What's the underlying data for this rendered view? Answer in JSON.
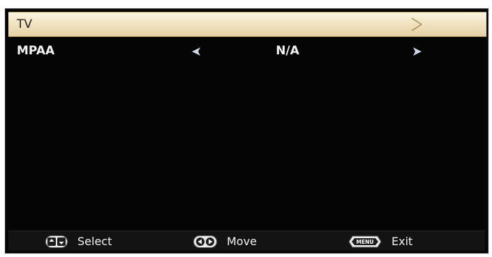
{
  "menu": {
    "items": [
      {
        "label": "TV",
        "icon": "chevron-right-outline-icon"
      },
      {
        "label": "MPAA",
        "value": "N/A",
        "left_icon": "arrow-left-icon",
        "right_icon": "arrow-right-icon"
      }
    ]
  },
  "footer": {
    "select_label": "Select",
    "select_icon": "up-down-keys-icon",
    "move_label": "Move",
    "move_icon": "left-right-keys-icon",
    "exit_label": "Exit",
    "menu_key_label": "MENU"
  },
  "colors": {
    "background": "#050505",
    "highlight": "#f5ecd2",
    "highlight_text": "#222222",
    "text": "#f2f2f2"
  }
}
